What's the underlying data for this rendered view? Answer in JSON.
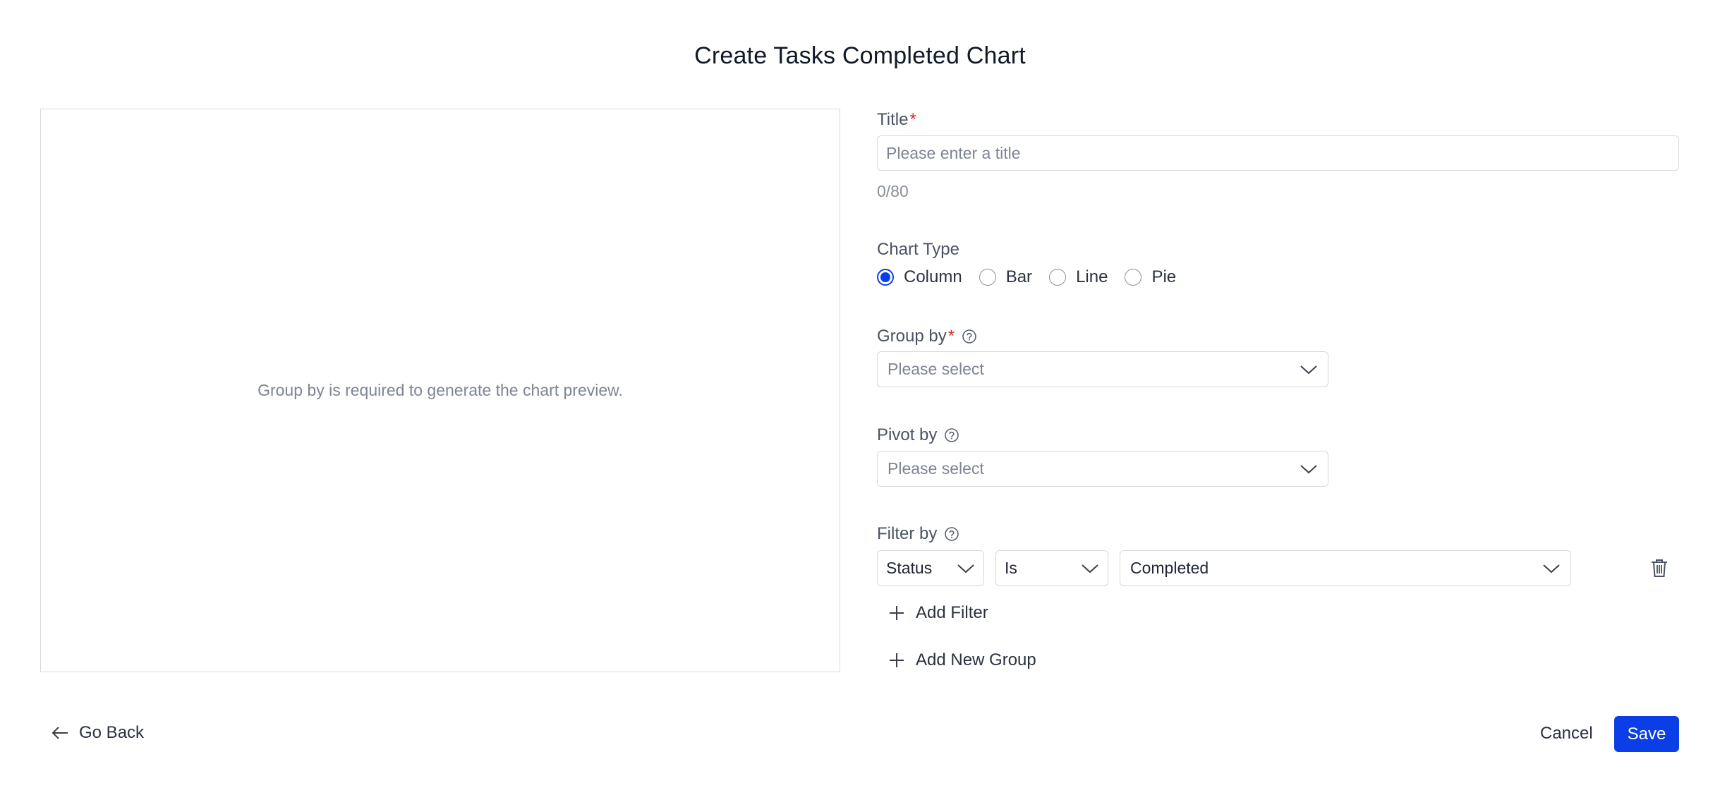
{
  "header": {
    "title": "Create Tasks Completed Chart"
  },
  "preview": {
    "message": "Group by is required to generate the chart preview."
  },
  "form": {
    "title": {
      "label": "Title",
      "required_mark": "*",
      "placeholder": "Please enter a title",
      "value": "",
      "counter": "0/80"
    },
    "chart_type": {
      "label": "Chart Type",
      "options": [
        "Column",
        "Bar",
        "Line",
        "Pie"
      ],
      "selected": "Column"
    },
    "group_by": {
      "label": "Group by",
      "required_mark": "*",
      "placeholder": "Please select",
      "help_icon": "question-circle-icon"
    },
    "pivot_by": {
      "label": "Pivot by",
      "placeholder": "Please select",
      "help_icon": "question-circle-icon"
    },
    "filter_by": {
      "label": "Filter by",
      "help_icon": "question-circle-icon",
      "filters": [
        {
          "field": "Status",
          "operator": "Is",
          "value": "Completed",
          "delete_icon": "trash-icon"
        }
      ],
      "add_filter_label": "Add Filter",
      "add_group_label": "Add New Group"
    }
  },
  "footer": {
    "back_label": "Go Back",
    "cancel_label": "Cancel",
    "save_label": "Save"
  },
  "colors": {
    "primary": "#0b3ee6",
    "required": "#d12c2c",
    "border": "#d6d8de",
    "muted_text": "#7d8494"
  }
}
